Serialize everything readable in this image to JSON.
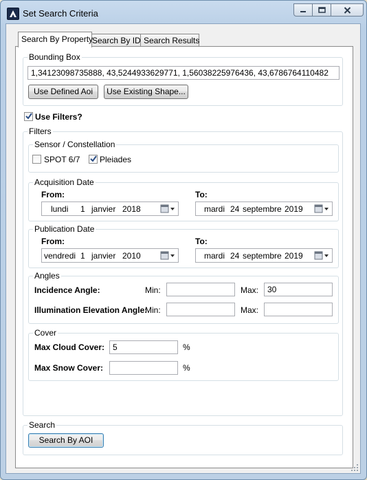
{
  "window": {
    "title": "Set Search Criteria"
  },
  "tabs": [
    {
      "label": "Search By Property",
      "active": true
    },
    {
      "label": "Search By ID",
      "active": false
    },
    {
      "label": "Search Results",
      "active": false
    }
  ],
  "bounding_box": {
    "label": "Bounding Box",
    "value": "1,34123098735888, 43,5244933629771, 1,56038225976436, 43,6786764110482",
    "use_defined_aoi": "Use Defined Aoi",
    "use_existing_shape": "Use Existing Shape..."
  },
  "use_filters": {
    "label": "Use Filters?",
    "checked": true
  },
  "filters": {
    "label": "Filters",
    "sensor": {
      "label": "Sensor / Constellation",
      "spot_label": "SPOT 6/7",
      "spot_checked": false,
      "pleiades_label": "Pleiades",
      "pleiades_checked": true
    },
    "acquisition": {
      "label": "Acquisition Date",
      "from_label": "From:",
      "to_label": "To:",
      "from": {
        "weekday": "lundi",
        "day": "1",
        "month": "janvier",
        "year": "2018"
      },
      "to": {
        "weekday": "mardi",
        "day": "24",
        "month": "septembre",
        "year": "2019"
      }
    },
    "publication": {
      "label": "Publication Date",
      "from_label": "From:",
      "to_label": "To:",
      "from": {
        "weekday": "vendredi",
        "day": "1",
        "month": "janvier",
        "year": "2010"
      },
      "to": {
        "weekday": "mardi",
        "day": "24",
        "month": "septembre",
        "year": "2019"
      }
    },
    "angles": {
      "label": "Angles",
      "min_label": "Min:",
      "max_label": "Max:",
      "incidence_label": "Incidence Angle:",
      "incidence_min": "",
      "incidence_max": "30",
      "illumination_label": "Illumination Elevation Angle:",
      "illumination_min": "",
      "illumination_max": ""
    },
    "cover": {
      "label": "Cover",
      "cloud_label": "Max Cloud Cover:",
      "cloud_value": "5",
      "snow_label": "Max Snow Cover:",
      "snow_value": "",
      "percent": "%"
    }
  },
  "search": {
    "label": "Search",
    "button": "Search By AOI"
  },
  "colors": {
    "accent": "#3c7fb1",
    "checkmark": "#2c4f86"
  }
}
